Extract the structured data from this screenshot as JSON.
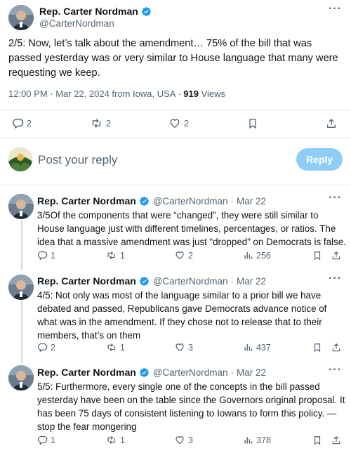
{
  "main_tweet": {
    "author_name": "Rep. Carter Nordman",
    "author_handle": "@CarterNordman",
    "text": "2/5: Now, let’s talk about the amendment… 75% of the bill that was passed yesterday was or very similar to House language that many were requesting we keep.",
    "timestamp": "12:00 PM · Mar 22, 2024 from Iowa, USA · ",
    "views_count": "919",
    "views_label": " Views",
    "stats": {
      "replies": "2",
      "reposts": "2",
      "likes": "2"
    }
  },
  "reply_composer": {
    "placeholder": "Post your reply",
    "button_label": "Reply"
  },
  "replies": [
    {
      "author_name": "Rep. Carter Nordman",
      "author_handle": "@CarterNordman",
      "date": "Mar 22",
      "text": "3/5Of the components that were “changed”, they were still similar to House language just with different timelines, percentages, or ratios. The idea that a massive amendment was just “dropped” on Democrats is false.",
      "replies": "1",
      "reposts": "1",
      "likes": "2",
      "views": "256"
    },
    {
      "author_name": "Rep. Carter Nordman",
      "author_handle": "@CarterNordman",
      "date": "Mar 22",
      "text": "4/5: Not only was most of the language similar to a prior bill we have debated and passed, Republicans gave Democrats advance notice of what was in the amendment. If they chose not to release that to their members, that’s on them",
      "replies": "2",
      "reposts": "1",
      "likes": "3",
      "views": "437"
    },
    {
      "author_name": "Rep. Carter Nordman",
      "author_handle": "@CarterNordman",
      "date": "Mar 22",
      "text": "5/5: Furthermore, every single one of the concepts in the bill passed yesterday have been on the table since the Governors original proposal. It has been 75 days of consistent listening to Iowans to form this policy. — stop the fear mongering",
      "replies": "1",
      "reposts": "1",
      "likes": "3",
      "views": "378"
    }
  ],
  "colors": {
    "verified": "#1d9bf0",
    "secondary_text": "#536471",
    "reply_button": "#8ecdf8",
    "divider": "#e6ecf0"
  }
}
